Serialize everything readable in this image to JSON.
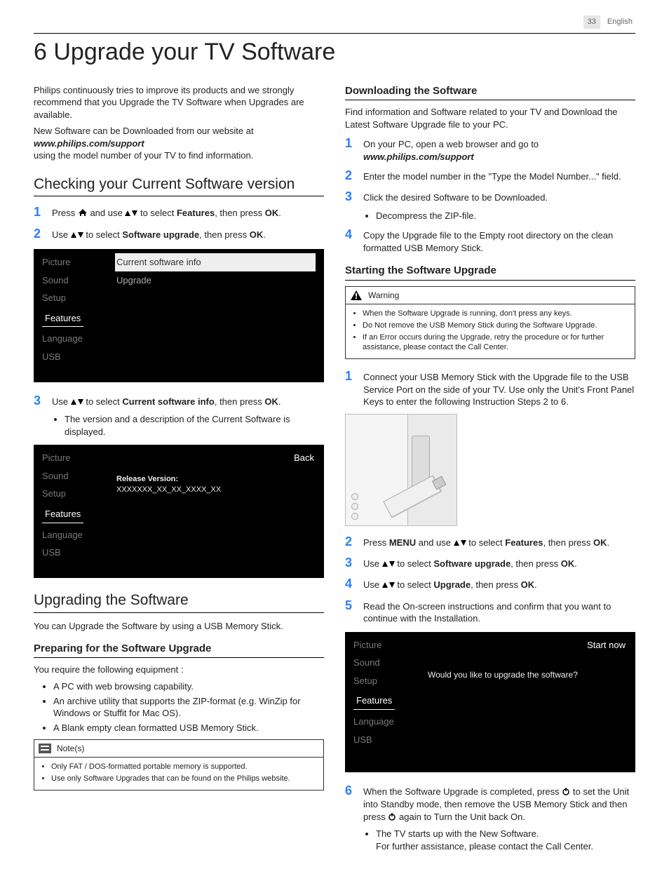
{
  "header": {
    "page": "33",
    "lang": "English"
  },
  "title": "6 Upgrade your TV Software",
  "intro": {
    "p1": "Philips continuously tries to improve its products and we strongly recommend that you Upgrade the TV Software when Upgrades are available.",
    "p2a": "New Software can be Downloaded from our website at",
    "url": "www.philips.com/support",
    "p2b": "using the model number of your TV to find information."
  },
  "checking": {
    "heading": "Checking your Current Software version",
    "step1a": "Press ",
    "step1b": " and use ",
    "step1c": " to select ",
    "step1_features": "Features",
    "step1d": ", then press ",
    "step1_ok": "OK",
    "step1e": ".",
    "step2a": "Use ",
    "step2b": " to select ",
    "step2_su": "Software upgrade",
    "step2c": ", then press ",
    "step2_ok": "OK",
    "step2d": ".",
    "step3a": "Use ",
    "step3b": " to select ",
    "step3_csi": "Current software info",
    "step3c": ", then press ",
    "step3_ok": "OK",
    "step3d": ".",
    "step3_bullet": "The version and a description of the Current Software is displayed."
  },
  "menu": {
    "items": [
      "Picture",
      "Sound",
      "Setup",
      "Features",
      "Language",
      "USB"
    ],
    "right1a": "Current software info",
    "right1b": "Upgrade",
    "back": "Back",
    "release_label": "Release Version:",
    "release_value": "XXXXXXX_XX_XX_XXXX_XX"
  },
  "upgrading": {
    "heading": "Upgrading the Software",
    "intro": "You can Upgrade the Software by using a USB Memory Stick.",
    "prep_heading": "Preparing for the Software Upgrade",
    "prep_intro": "You require the following equipment :",
    "prep_b1": "A PC with web browsing capability.",
    "prep_b2": "An archive utility that supports the ZIP-format (e.g. WinZip for Windows or Stuffit for Mac OS).",
    "prep_b3": "A Blank empty clean formatted USB Memory Stick.",
    "notes_label": "Note(s)",
    "note1": "Only FAT / DOS-formatted portable memory is supported.",
    "note2": "Use only Software Upgrades that can be found on the Philips website."
  },
  "downloading": {
    "heading": "Downloading the Software",
    "intro": "Find information and Software related to your TV and Download the Latest Software Upgrade file to your PC.",
    "s1": "On your PC, open a web browser and go to",
    "s1_url": "www.philips.com/support",
    "s2": "Enter the model number in the \"Type the Model Number...\" field.",
    "s3": "Click the desired Software to be Downloaded.",
    "s3_b": "Decompress the ZIP-file.",
    "s4": "Copy the Upgrade file to the Empty root directory on the clean formatted USB Memory Stick."
  },
  "starting": {
    "heading": "Starting the Software Upgrade",
    "warn_label": "Warning",
    "w1": "When the Software Upgrade is running, don't press any keys.",
    "w2": "Do Not remove the USB Memory Stick during the Software Upgrade.",
    "w3": "If an Error occurs during the Upgrade, retry the procedure or for further assistance, please contact the Call Center.",
    "s1": "Connect your USB Memory Stick with the Upgrade file to the USB Service Port on the side of your TV. Use only the Unit's Front Panel Keys to enter the following Instruction Steps 2 to 6.",
    "s2a": "Press ",
    "s2_menu": "MENU",
    "s2b": " and use ",
    "s2c": " to select ",
    "s2_features": "Features",
    "s2d": ", then press ",
    "s2_ok": "OK",
    "s2e": ".",
    "s3a": "Use ",
    "s3b": " to select ",
    "s3_su": "Software upgrade",
    "s3c": ", then press ",
    "s3_ok": "OK",
    "s3d": ".",
    "s4a": "Use ",
    "s4b": " to select ",
    "s4_up": "Upgrade",
    "s4c": ", then press ",
    "s4_ok": "OK",
    "s4d": ".",
    "s5": "Read the On-screen instructions and confirm that you want to continue with the Installation.",
    "menu_q": "Would you like to upgrade the software?",
    "menu_start": "Start now",
    "s6a": "When the Software Upgrade is completed, press ",
    "s6b": " to set the Unit into Standby mode, then remove the USB Memory Stick and then press ",
    "s6c": " again to Turn the Unit back On.",
    "s6_b1": "The TV starts up with the New Software.",
    "s6_b2": "For further assistance, please contact the Call Center."
  }
}
